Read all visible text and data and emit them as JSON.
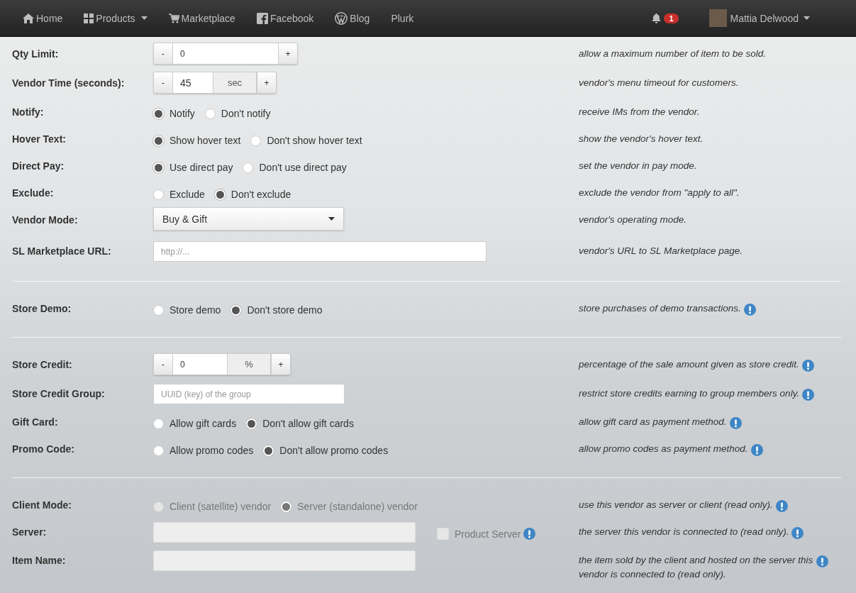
{
  "navbar": {
    "items": [
      {
        "label": "Home"
      },
      {
        "label": "Products",
        "caret": true
      },
      {
        "label": "Marketplace"
      },
      {
        "label": "Facebook"
      },
      {
        "label": "Blog"
      },
      {
        "label": "Plurk"
      }
    ],
    "notifications": {
      "count": "1"
    },
    "user": {
      "name": "Mattia Delwood",
      "caret": true
    }
  },
  "sections": [
    {
      "rows": [
        {
          "kind": "stepper",
          "label": "Qty Limit:",
          "minus": "-",
          "value": "0",
          "plus": "+",
          "description": "allow a maximum number of item to be sold."
        },
        {
          "kind": "stepper",
          "label": "Vendor Time (seconds):",
          "minus": "-",
          "value": "45",
          "unit": "sec",
          "plus": "+",
          "description": "vendor's menu timeout for customers."
        },
        {
          "kind": "radio",
          "label": "Notify:",
          "options": [
            {
              "label": "Notify",
              "selected": true
            },
            {
              "label": "Don't notify",
              "selected": false
            }
          ],
          "description": "receive IMs from the vendor."
        },
        {
          "kind": "radio",
          "label": "Hover Text:",
          "options": [
            {
              "label": "Show hover text",
              "selected": true
            },
            {
              "label": "Don't show hover text",
              "selected": false
            }
          ],
          "description": "show the vendor's hover text."
        },
        {
          "kind": "radio",
          "label": "Direct Pay:",
          "options": [
            {
              "label": "Use direct pay",
              "selected": true
            },
            {
              "label": "Don't use direct pay",
              "selected": false
            }
          ],
          "description": "set the vendor in pay mode."
        },
        {
          "kind": "radio",
          "label": "Exclude:",
          "options": [
            {
              "label": "Exclude",
              "selected": false
            },
            {
              "label": "Don't exclude",
              "selected": true
            }
          ],
          "description": "exclude the vendor from \"apply to all\"."
        },
        {
          "kind": "select",
          "label": "Vendor Mode:",
          "value": "Buy & Gift",
          "description": "vendor's operating mode."
        },
        {
          "kind": "text",
          "label": "SL Marketplace URL:",
          "placeholder": "http://...",
          "description": "vendor's URL to SL Marketplace page."
        }
      ]
    },
    {
      "rows": [
        {
          "kind": "radio",
          "label": "Store Demo:",
          "options": [
            {
              "label": "Store demo",
              "selected": false
            },
            {
              "label": "Don't store demo",
              "selected": true
            }
          ],
          "description": "store purchases of demo transactions.",
          "info": true
        }
      ]
    },
    {
      "rows": [
        {
          "kind": "stepper",
          "label": "Store Credit:",
          "minus": "-",
          "value": "0",
          "unit": "%",
          "plus": "+",
          "description": "percentage of the sale amount given as store credit.",
          "info": true
        },
        {
          "kind": "text",
          "label": "Store Credit Group:",
          "placeholder": "UUID (key) of the group",
          "description": "restrict store credits earning to group members only.",
          "info": true
        },
        {
          "kind": "radio",
          "label": "Gift Card:",
          "options": [
            {
              "label": "Allow gift cards",
              "selected": false
            },
            {
              "label": "Don't allow gift cards",
              "selected": true
            }
          ],
          "description": "allow gift card as payment method.",
          "info": true
        },
        {
          "kind": "radio",
          "label": "Promo Code:",
          "options": [
            {
              "label": "Allow promo codes",
              "selected": false
            },
            {
              "label": "Don't allow promo codes",
              "selected": true
            }
          ],
          "description": "allow promo codes as payment method.",
          "info": true
        }
      ]
    },
    {
      "rows": [
        {
          "kind": "radio",
          "label": "Client Mode:",
          "disabled": true,
          "options": [
            {
              "label": "Client (satellite) vendor",
              "selected": false
            },
            {
              "label": "Server (standalone) vendor",
              "selected": true
            }
          ],
          "description": "use this vendor as server or client (read only).",
          "info": true
        },
        {
          "kind": "text",
          "label": "Server:",
          "disabled": true,
          "checkbox": {
            "label": "Product Server",
            "checked": false,
            "disabled": true,
            "info": true
          },
          "description": "the server this vendor is connected to (read only).",
          "info": true
        },
        {
          "kind": "text",
          "label": "Item Name:",
          "disabled": true,
          "description": "the item sold by the client and hosted on the server this vendor is connected to (read only).",
          "info": true
        }
      ]
    }
  ]
}
